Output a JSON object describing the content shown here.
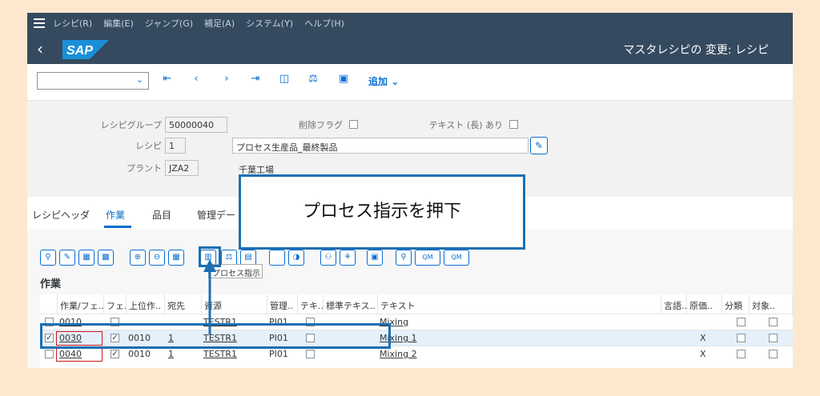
{
  "menubar": {
    "items": [
      "レシピ(R)",
      "編集(E)",
      "ジャンプ(G)",
      "補足(A)",
      "システム(Y)",
      "ヘルプ(H)"
    ]
  },
  "shell": {
    "logo": "SAP",
    "title": "マスタレシピの 変更: レシピ"
  },
  "toolbar": {
    "add_label": "追加"
  },
  "header": {
    "recipe_group_label": "レシピグループ",
    "recipe_group_value": "50000040",
    "delete_flag_label": "削除フラグ",
    "long_text_label": "テキスト (長) あり",
    "recipe_label": "レシピ",
    "recipe_value": "1",
    "recipe_text": "プロセス生産品_最終製品",
    "plant_label": "プラント",
    "plant_value": "JZA2",
    "plant_name": "千葉工場"
  },
  "tabs": [
    "レシピヘッダ",
    "作業",
    "品目",
    "管理デー"
  ],
  "content": {
    "section_title": "作業",
    "tooltip": "プロセス指示",
    "qm1": "QM",
    "qm2": "QM"
  },
  "grid": {
    "columns": [
      "作業/フェ..",
      "フェ..",
      "上位作..",
      "宛先",
      "資源",
      "管理..",
      "テキ..",
      "標準テキス..",
      "テキスト",
      "言語..",
      "原価..",
      "分類",
      "対象.."
    ],
    "rows": [
      {
        "selected": false,
        "op": "0010",
        "phase": false,
        "parent": "",
        "dest": "",
        "resource": "TESTR1",
        "ctrl": "PI01",
        "text": "Mixing",
        "cost": ""
      },
      {
        "selected": true,
        "op": "0030",
        "phase": true,
        "parent": "0010",
        "dest": "1",
        "resource": "TESTR1",
        "ctrl": "PI01",
        "text": "Mixing 1",
        "cost": "X"
      },
      {
        "selected": false,
        "op": "0040",
        "phase": true,
        "parent": "0010",
        "dest": "1",
        "resource": "TESTR1",
        "ctrl": "PI01",
        "text": "Mixing 2",
        "cost": "X"
      }
    ]
  },
  "callout": {
    "text": "プロセス指示を押下"
  },
  "colors": {
    "shell": "#354a5f",
    "accent": "#0a6ed1",
    "callout_border": "#1b6fb3",
    "background": "#fde8cf"
  }
}
